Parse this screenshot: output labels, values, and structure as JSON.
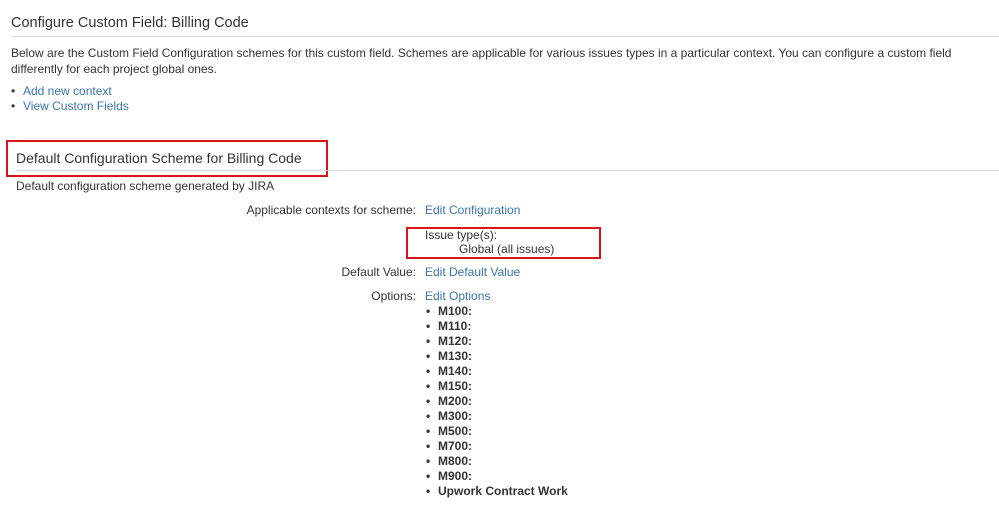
{
  "title": "Configure Custom Field: Billing Code",
  "description_line1": "Below are the Custom Field Configuration schemes for this custom field. Schemes are applicable for various issues types in a particular context. You can configure a custom field differently for each project",
  "description_line2": "global ones.",
  "links": [
    "Add new context",
    "View Custom Fields"
  ],
  "scheme": {
    "heading": "Default Configuration Scheme for Billing Code",
    "subtitle": "Default configuration scheme generated by JIRA",
    "contexts_label": "Applicable contexts for scheme:",
    "contexts_link": "Edit Configuration",
    "issue_types_label": "Issue type(s):",
    "issue_types_value": "Global (all issues)",
    "default_label": "Default Value:",
    "default_link": "Edit Default Value",
    "options_label": "Options:",
    "options_link": "Edit Options",
    "options": [
      "M100:",
      "M110:",
      "M120:",
      "M130:",
      "M140:",
      "M150:",
      "M200:",
      "M300:",
      "M500:",
      "M700:",
      "M800:",
      "M900:",
      "Upwork Contract Work"
    ]
  }
}
